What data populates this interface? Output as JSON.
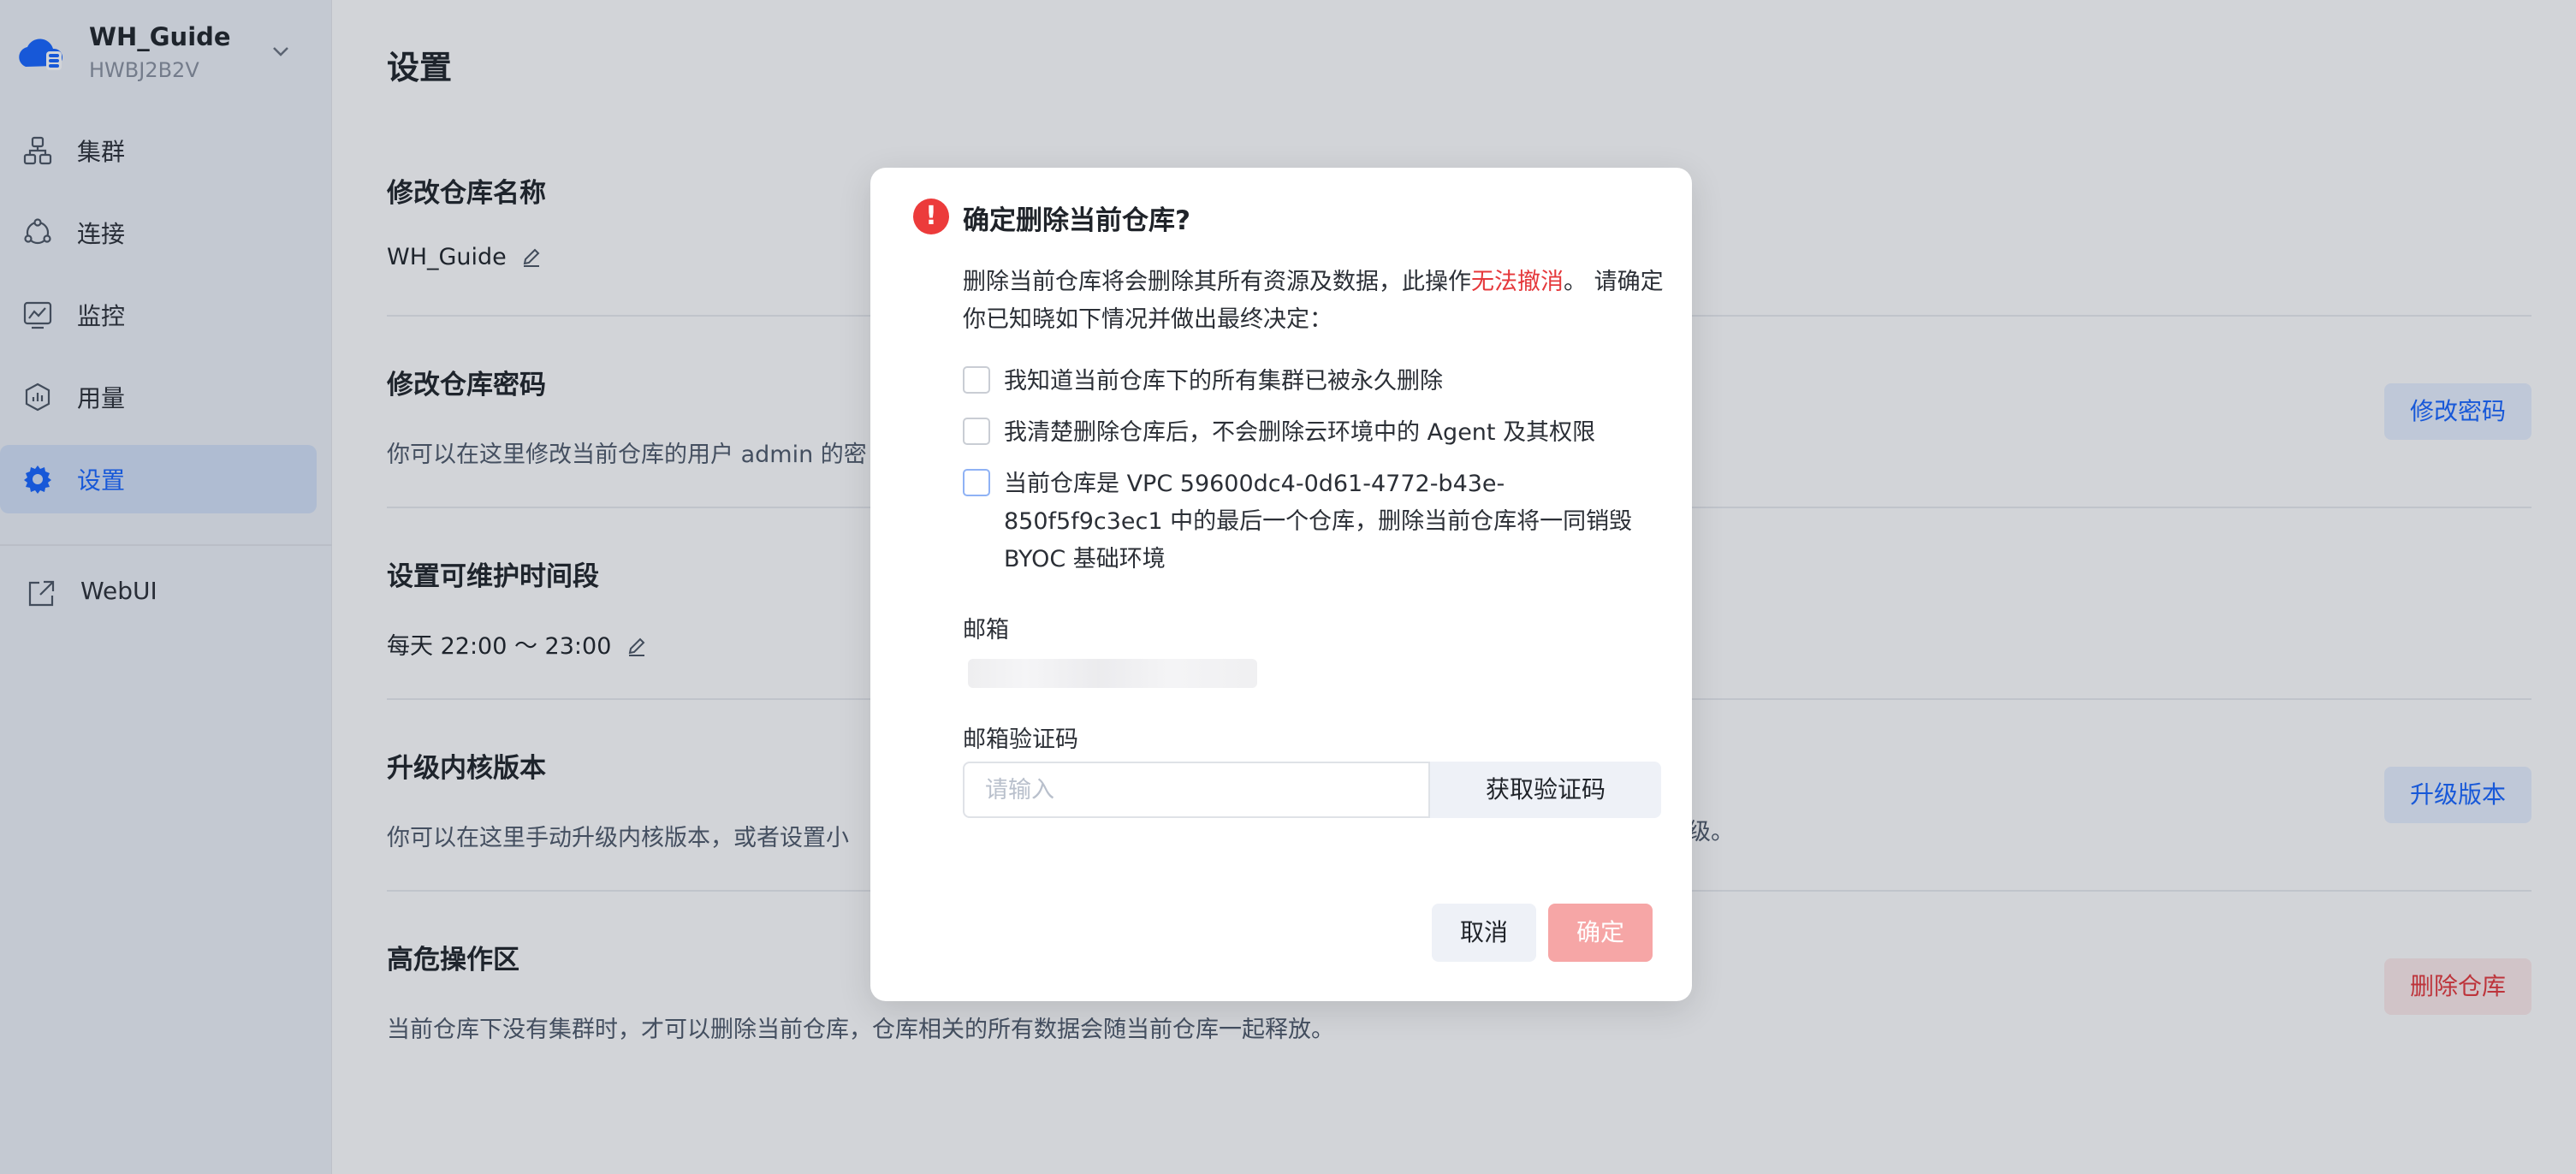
{
  "workspace": {
    "name": "WH_Guide",
    "id": "HWBJ2B2V"
  },
  "sidebar": {
    "items": [
      {
        "label": "集群",
        "icon": "cluster-icon"
      },
      {
        "label": "连接",
        "icon": "connection-icon"
      },
      {
        "label": "监控",
        "icon": "monitor-icon"
      },
      {
        "label": "用量",
        "icon": "usage-icon"
      },
      {
        "label": "设置",
        "icon": "gear-icon",
        "active": true
      }
    ],
    "external": {
      "label": "WebUI",
      "icon": "external-link-icon"
    }
  },
  "page": {
    "title": "设置"
  },
  "sections": {
    "rename": {
      "title": "修改仓库名称",
      "value": "WH_Guide"
    },
    "password": {
      "title": "修改仓库密码",
      "desc": "你可以在这里修改当前仓库的用户 admin 的密",
      "button": "修改密码"
    },
    "maintenance": {
      "title": "设置可维护时间段",
      "value": "每天 22:00 ～ 23:00"
    },
    "upgrade": {
      "title": "升级内核版本",
      "desc_left": "你可以在这里手动升级内核版本，或者设置小",
      "desc_right": "级。",
      "button": "升级版本"
    },
    "danger": {
      "title": "高危操作区",
      "desc": "当前仓库下没有集群时，才可以删除当前仓库，仓库相关的所有数据会随当前仓库一起释放。",
      "button": "删除仓库"
    }
  },
  "modal": {
    "title": "确定删除当前仓库?",
    "desc_prefix": "删除当前仓库将会删除其所有资源及数据，此操作",
    "desc_danger": "无法撤消",
    "desc_suffix": "。 请确定你已知晓如下情况并做出最终决定：",
    "checks": [
      "我知道当前仓库下的所有集群已被永久删除",
      "我清楚删除仓库后，不会删除云环境中的 Agent 及其权限",
      "当前仓库是 VPC 59600dc4-0d61-4772-b43e-850f5f9c3ec1 中的最后一个仓库，删除当前仓库将一同销毁 BYOC 基础环境"
    ],
    "email_label": "邮箱",
    "code_label": "邮箱验证码",
    "code_placeholder": "请输入",
    "code_button": "获取验证码",
    "cancel": "取消",
    "confirm": "确定"
  },
  "colors": {
    "accent": "#1664ff",
    "danger": "#e5383b",
    "confirm_disabled": "#f6a6a6"
  }
}
